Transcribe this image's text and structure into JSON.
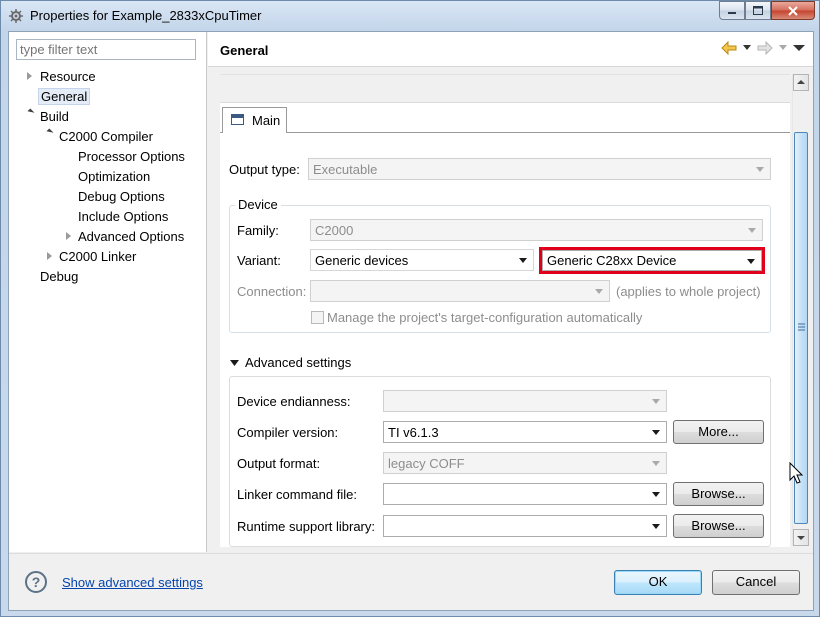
{
  "window": {
    "title": "Properties for Example_2833xCpuTimer"
  },
  "sidebar": {
    "filter_placeholder": "type filter text",
    "items": [
      {
        "label": "Resource"
      },
      {
        "label": "General"
      },
      {
        "label": "Build"
      },
      {
        "label": "C2000 Compiler"
      },
      {
        "label": "Processor Options"
      },
      {
        "label": "Optimization"
      },
      {
        "label": "Debug Options"
      },
      {
        "label": "Include Options"
      },
      {
        "label": "Advanced Options"
      },
      {
        "label": "C2000 Linker"
      },
      {
        "label": "Debug"
      }
    ]
  },
  "page": {
    "title": "General"
  },
  "tabs": [
    {
      "label": "Main"
    }
  ],
  "main": {
    "output_type_label": "Output type:",
    "output_type_value": "Executable",
    "device_group_label": "Device",
    "family_label": "Family:",
    "family_value": "C2000",
    "variant_label": "Variant:",
    "variant_filter_value": "Generic devices",
    "variant_value": "Generic C28xx Device",
    "connection_label": "Connection:",
    "connection_value": "",
    "connection_note": "(applies to whole project)",
    "manage_checkbox_label": "Manage the project's target-configuration automatically"
  },
  "advanced": {
    "section_label": "Advanced settings",
    "endianness_label": "Device endianness:",
    "endianness_value": "",
    "compiler_label": "Compiler version:",
    "compiler_value": "TI v6.1.3",
    "more_button": "More...",
    "output_format_label": "Output format:",
    "output_format_value": "legacy COFF",
    "linker_cmd_label": "Linker command file:",
    "linker_cmd_value": "",
    "browse_button_1": "Browse...",
    "rts_label": "Runtime support library:",
    "rts_value": "",
    "browse_button_2": "Browse..."
  },
  "footer": {
    "help_glyph": "?",
    "advanced_link": "Show advanced settings",
    "ok_button": "OK",
    "cancel_button": "Cancel"
  },
  "colors": {
    "highlight": "#e0001b",
    "link": "#0645ad",
    "scroll_thumb": "#c8e2f7"
  }
}
